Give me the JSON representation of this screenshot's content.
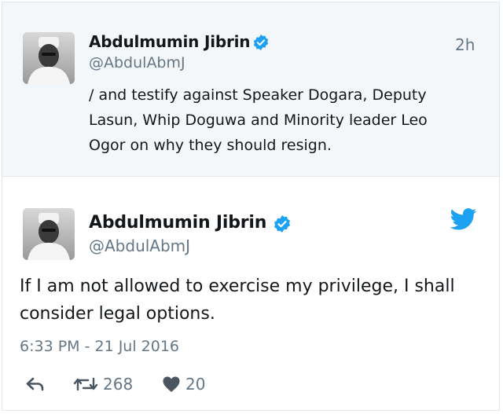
{
  "parent_tweet": {
    "author_name": "Abdulmumin Jibrin",
    "handle": "@AbdulAbmJ",
    "time_ago": "2h",
    "text": "/ and testify against Speaker Dogara, Deputy Lasun, Whip Doguwa and Minority leader Leo Ogor on why they should resign."
  },
  "main_tweet": {
    "author_name": "Abdulmumin Jibrin",
    "handle": "@AbdulAbmJ",
    "text": "If I am not allowed to exercise my privilege, I shall consider legal options.",
    "timestamp": "6:33 PM - 21 Jul 2016",
    "retweet_count": "268",
    "like_count": "20"
  },
  "colors": {
    "verified": "#1da1f2",
    "bird": "#1da1f2",
    "muted_text": "#657786",
    "parent_bg": "#f4f7f9"
  },
  "icons": [
    "verified-badge-icon",
    "twitter-bird-icon",
    "reply-icon",
    "retweet-icon",
    "heart-icon"
  ]
}
